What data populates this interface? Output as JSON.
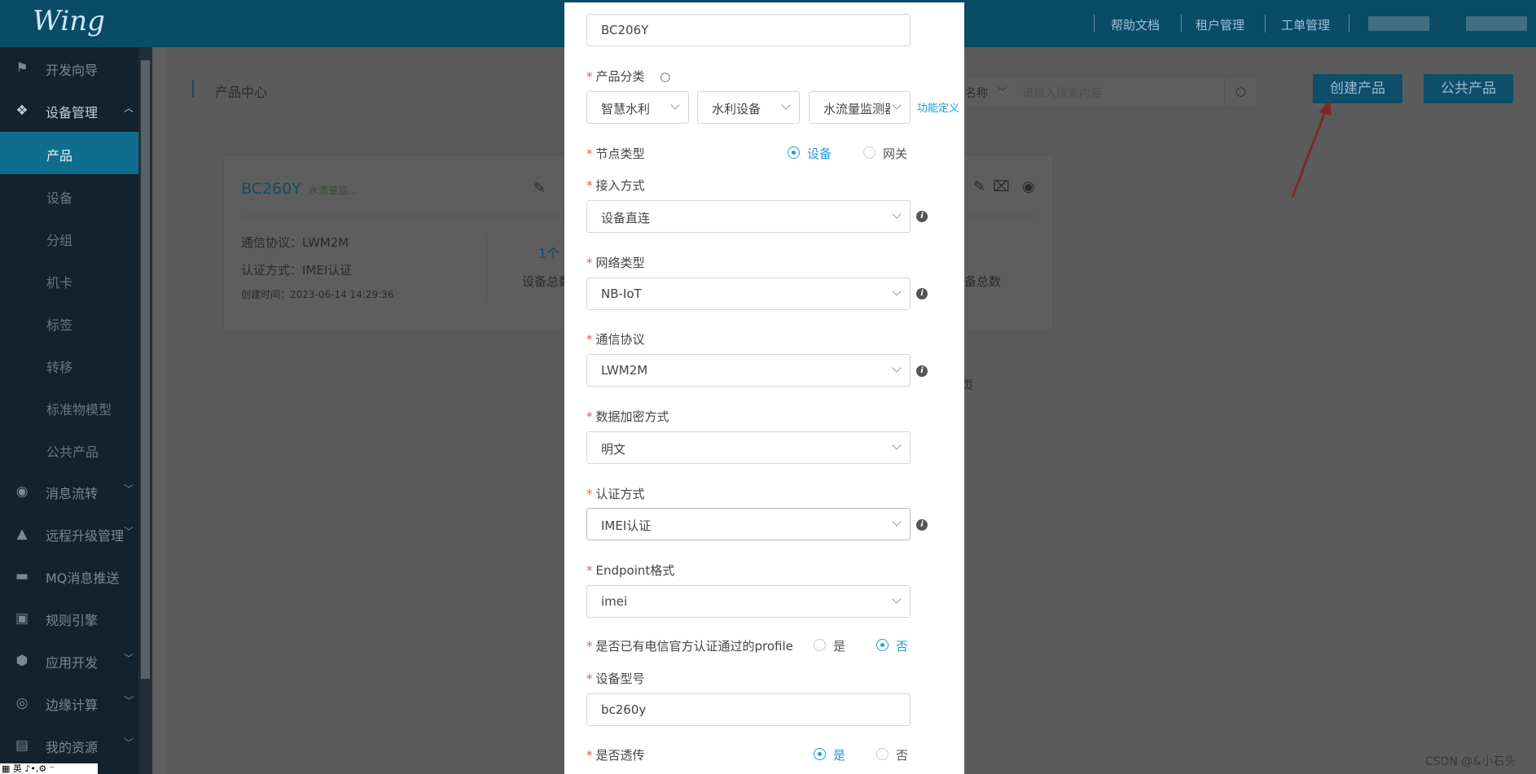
{
  "topbar": {
    "logo": "Wing",
    "links": [
      "帮助文档",
      "租户管理",
      "工单管理"
    ]
  },
  "sidebar": {
    "items": [
      {
        "label": "开发向导",
        "icon": "signpost-icon"
      },
      {
        "label": "设备管理",
        "icon": "grid-icon"
      },
      {
        "label": "消息流转",
        "icon": "message-flow-icon"
      },
      {
        "label": "远程升级管理",
        "icon": "rocket-icon"
      },
      {
        "label": "MQ消息推送",
        "icon": "chat-icon"
      },
      {
        "label": "规则引擎",
        "icon": "rule-icon"
      },
      {
        "label": "应用开发",
        "icon": "app-dev-icon"
      },
      {
        "label": "边缘计算",
        "icon": "edge-icon"
      },
      {
        "label": "我的资源",
        "icon": "resource-icon"
      }
    ],
    "sub_items": [
      "产品",
      "设备",
      "分组",
      "机卡",
      "标签",
      "转移",
      "标准物模型",
      "公共产品"
    ]
  },
  "content": {
    "page_title": "产品中心",
    "search_select": "名称",
    "search_placeholder": "请输入搜索内容",
    "create_button": "创建产品",
    "public_button": "公共产品",
    "card": {
      "name": "BC260Y",
      "tag": "水流量监...",
      "protocol": "通信协议：LWM2M",
      "auth": "认证方式：IMEI认证",
      "created": "创建时间：2023-06-14 14:29:36",
      "count": "1个",
      "count_label": "设备总数",
      "count_label_right": "备总数",
      "page_fragment": "页"
    }
  },
  "modal": {
    "product_name": "BC206Y",
    "category_label": "产品分类",
    "category": [
      "智慧水利",
      "水利设备",
      "水流量监测器"
    ],
    "function_link": "功能定义",
    "node_label": "节点类型",
    "node_options": [
      "设备",
      "网关"
    ],
    "access_label": "接入方式",
    "access_value": "设备直连",
    "network_label": "网络类型",
    "network_value": "NB-IoT",
    "protocol_label": "通信协议",
    "protocol_value": "LWM2M",
    "encrypt_label": "数据加密方式",
    "encrypt_value": "明文",
    "auth_label": "认证方式",
    "auth_value": "IMEI认证",
    "endpoint_label": "Endpoint格式",
    "endpoint_value": "imei",
    "profile_label": "是否已有电信官方认证通过的profile",
    "yes": "是",
    "no": "否",
    "model_label": "设备型号",
    "model_value": "bc260y",
    "passthrough_label": "是否透传"
  },
  "watermark": "CSDN @&小石头",
  "ime_bar": "英"
}
